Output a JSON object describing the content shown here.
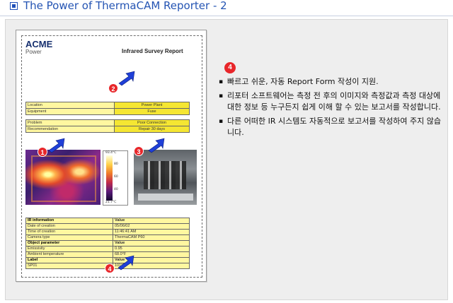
{
  "header": {
    "title": "The Power of ThermaCAM Reporter - 2",
    "icon": "square-bullet-icon",
    "accent_color": "#1f4fb8"
  },
  "report": {
    "logo_main": "ACME",
    "logo_sub": "Power",
    "title": "Infrared Survey Report",
    "summary_rows": [
      {
        "label": "Location",
        "value": "Power Plant"
      },
      {
        "label": "Equipment",
        "value": "Fuse"
      }
    ],
    "problem_rows": [
      {
        "label": "Problem",
        "value": "Poor Connection"
      },
      {
        "label": "Recommendation",
        "value": "Repair 30 days"
      }
    ],
    "scale": {
      "top": "93.4°C",
      "bottom": "21.7°C",
      "ticks": [
        "80",
        "60",
        "40"
      ]
    },
    "info_rows": [
      {
        "label": "IR information",
        "value": "Value",
        "bold": true
      },
      {
        "label": "Date of creation",
        "value": "05/06/02",
        "bold": false
      },
      {
        "label": "Time of creation",
        "value": "11:46:41 AM",
        "bold": false
      },
      {
        "label": "Camera type",
        "value": "ThermaCAM P60",
        "bold": false
      },
      {
        "label": "Object parameter",
        "value": "Value",
        "bold": true
      },
      {
        "label": "Emissivity",
        "value": "0.95",
        "bold": false
      },
      {
        "label": "Ambient temperature",
        "value": "68.0°F",
        "bold": false
      },
      {
        "label": "Label",
        "value": "Value",
        "bold": true
      },
      {
        "label": "SP01",
        "value": "101°F",
        "bold": false
      }
    ],
    "callouts": [
      "1",
      "2",
      "3",
      "4"
    ]
  },
  "side": {
    "badge": "4",
    "bullets": [
      "빠르고 쉬운, 자동 Report Form 작성이 지원.",
      "리포터 소프트웨어는 측정 전 후의 이미지와 측정값과 측정 대상에 대한 정보 등 누구든지 쉽게 이해 할 수 있는 보고서를 작성합니다.",
      "다른 어떠한 IR 시스템도 자동적으로 보고서를 작성하여 주지 않습니다."
    ]
  }
}
